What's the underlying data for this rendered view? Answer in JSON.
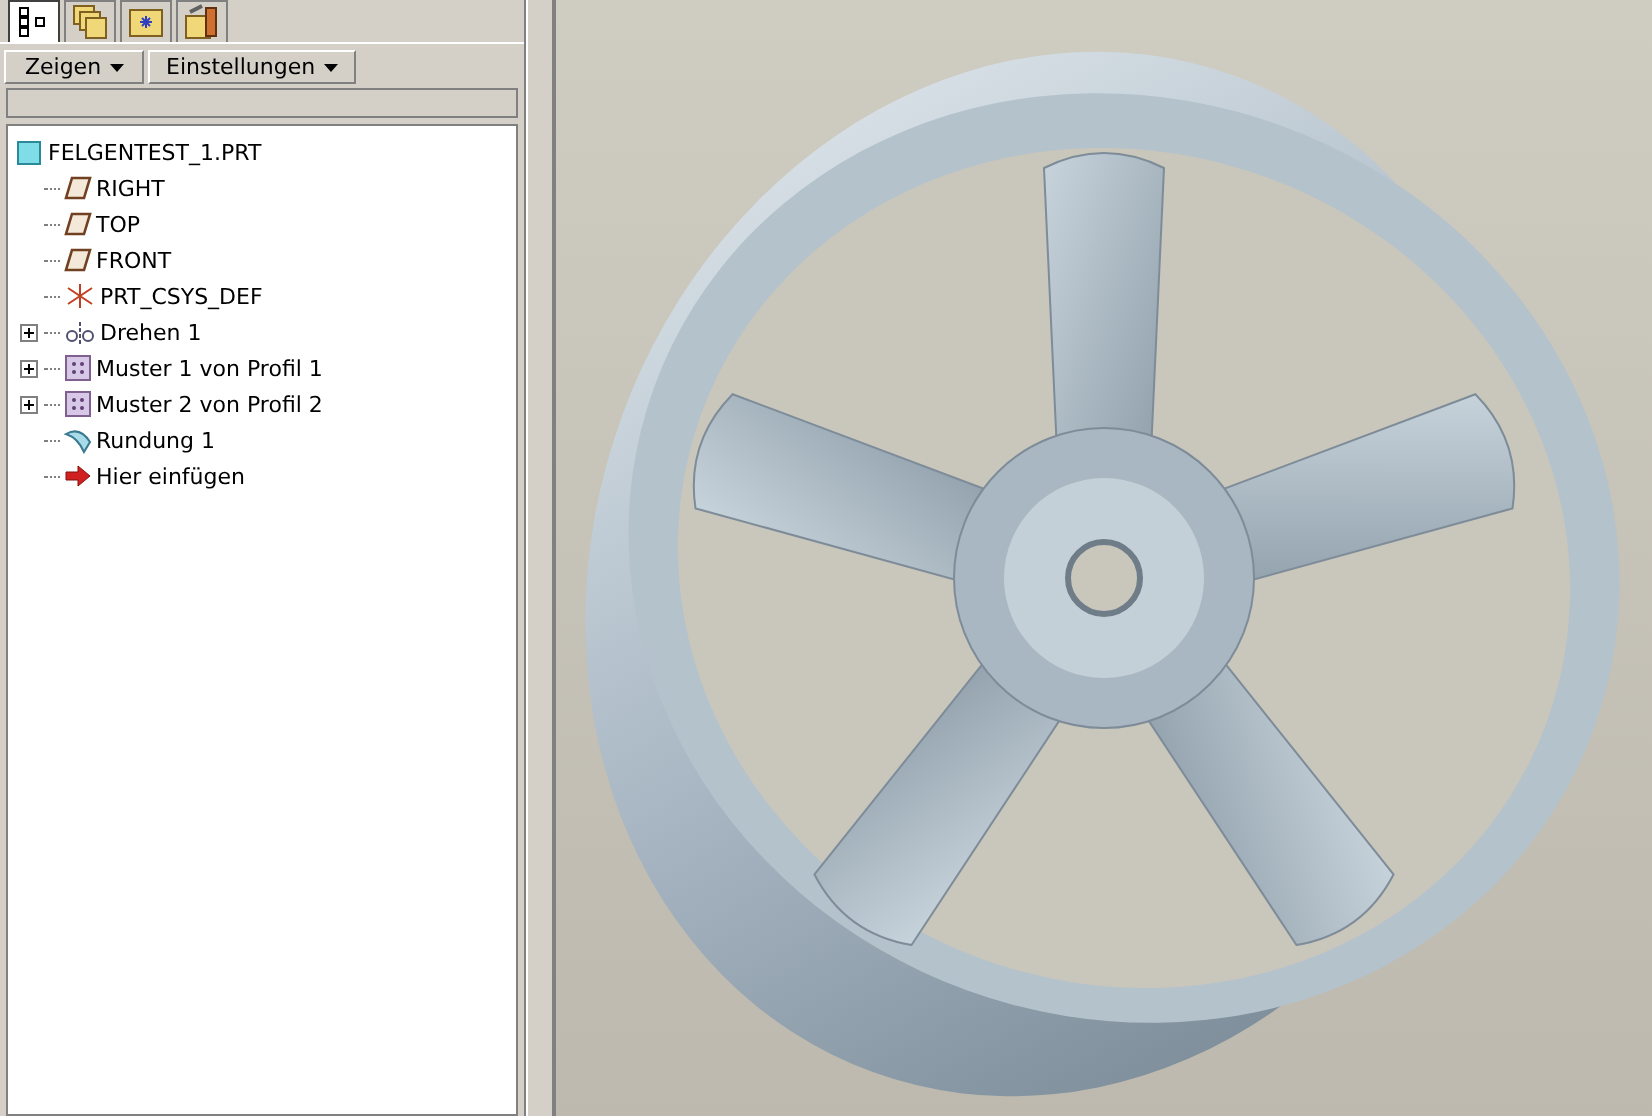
{
  "tabs": [
    {
      "kind": "tree",
      "selected": true
    },
    {
      "kind": "layers",
      "selected": false
    },
    {
      "kind": "folder-star",
      "selected": false
    },
    {
      "kind": "folder-tools",
      "selected": false
    }
  ],
  "toolbar": {
    "buttons": [
      "Zeigen",
      "Einstellungen"
    ]
  },
  "tree": {
    "root": "FELGENTEST_1.PRT",
    "items": [
      {
        "kind": "plane",
        "label": "RIGHT"
      },
      {
        "kind": "plane",
        "label": "TOP"
      },
      {
        "kind": "plane",
        "label": "FRONT"
      },
      {
        "kind": "csys",
        "label": "PRT_CSYS_DEF"
      },
      {
        "kind": "revolve",
        "label": "Drehen 1",
        "expanded": false
      },
      {
        "kind": "pattern",
        "label": "Muster 1 von Profil 1",
        "expanded": false
      },
      {
        "kind": "pattern",
        "label": "Muster 2 von Profil 2",
        "expanded": false
      },
      {
        "kind": "round",
        "label": "Rundung 1"
      },
      {
        "kind": "insert",
        "label": "Hier einfügen"
      }
    ]
  }
}
